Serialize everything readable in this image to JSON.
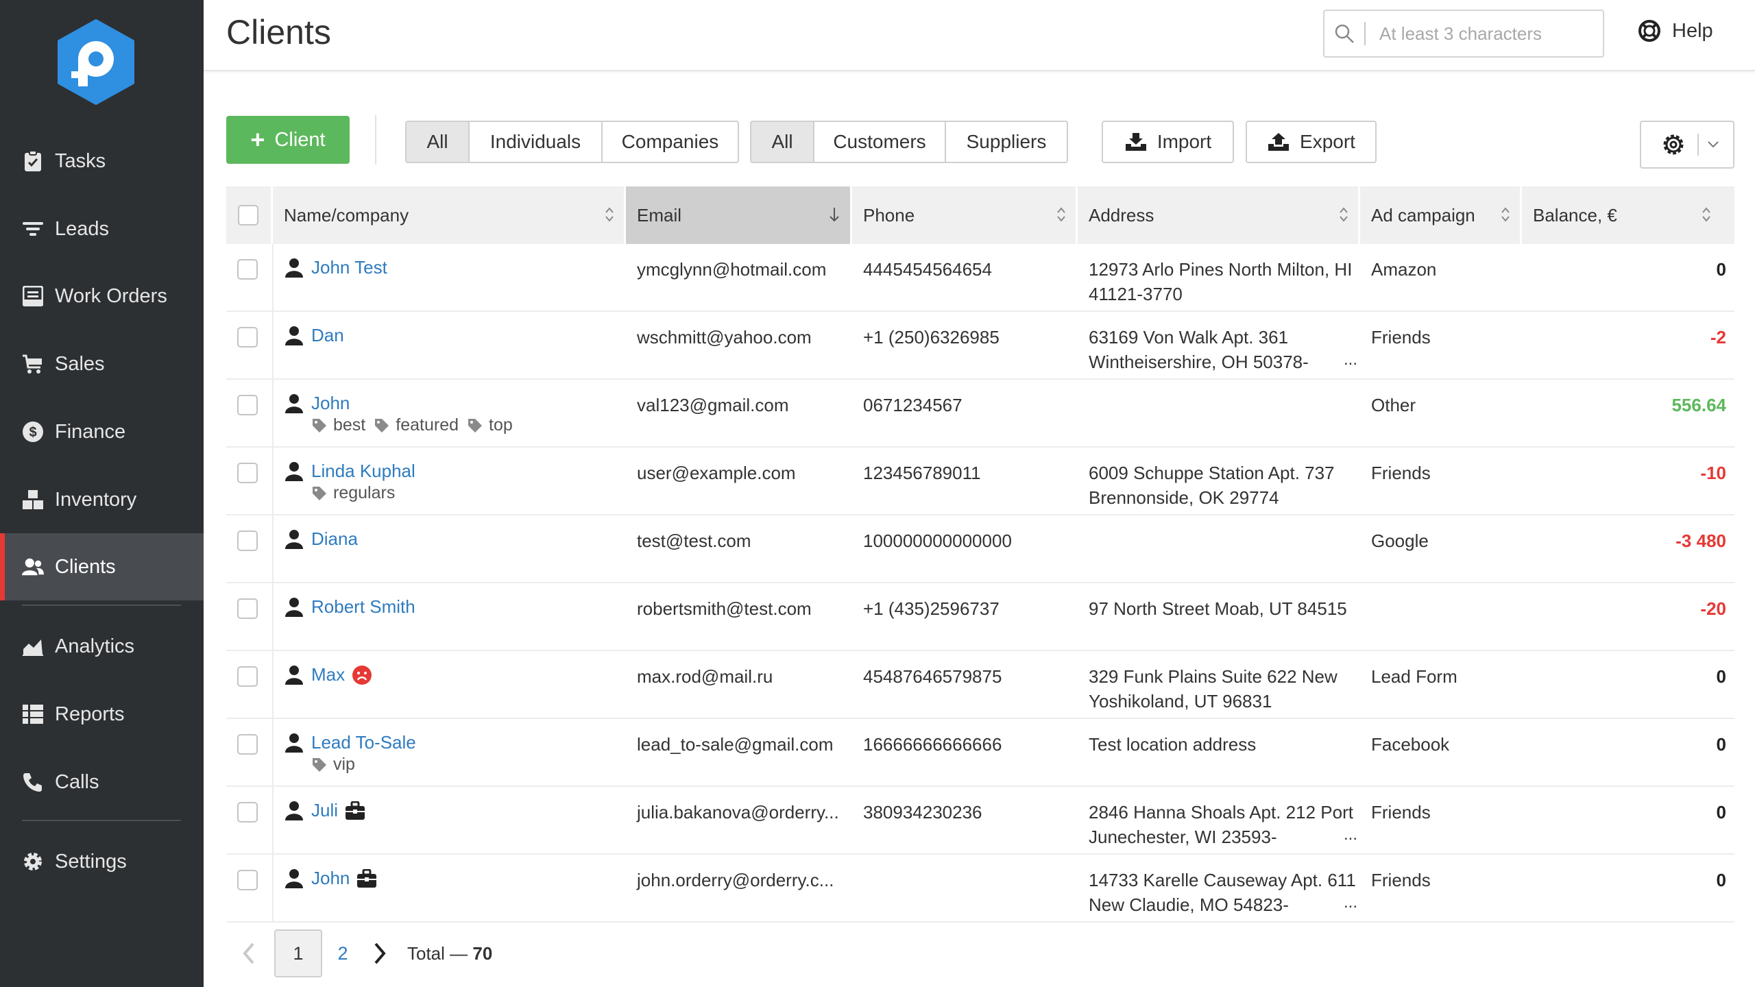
{
  "sidebar": {
    "items": [
      {
        "label": "Tasks",
        "icon": "clipboard-check-icon"
      },
      {
        "label": "Leads",
        "icon": "funnel-icon"
      },
      {
        "label": "Work Orders",
        "icon": "work-order-icon"
      },
      {
        "label": "Sales",
        "icon": "cart-icon"
      },
      {
        "label": "Finance",
        "icon": "dollar-icon"
      },
      {
        "label": "Inventory",
        "icon": "boxes-icon"
      },
      {
        "label": "Clients",
        "icon": "users-icon",
        "active": true
      },
      {
        "label": "Analytics",
        "icon": "chart-area-icon"
      },
      {
        "label": "Reports",
        "icon": "table-icon"
      },
      {
        "label": "Calls",
        "icon": "phone-icon"
      },
      {
        "label": "Settings",
        "icon": "gear-icon"
      }
    ]
  },
  "header": {
    "title": "Clients",
    "search_placeholder": "At least 3 characters",
    "help_label": "Help"
  },
  "toolbar": {
    "add_client_label": "Client",
    "type_filter": [
      "All",
      "Individuals",
      "Companies"
    ],
    "role_filter": [
      "All",
      "Customers",
      "Suppliers"
    ],
    "import_label": "Import",
    "export_label": "Export"
  },
  "table": {
    "columns": [
      "Name/company",
      "Email",
      "Phone",
      "Address",
      "Ad campaign",
      "Balance, €"
    ],
    "rows": [
      {
        "name": "John Test",
        "tags": [],
        "email": "ymcglynn@hotmail.com",
        "phone": "4445454564654",
        "address": "12973 Arlo Pines North Milton, HI 41121-3770",
        "campaign": "Amazon",
        "balance": "0",
        "balance_type": "zero"
      },
      {
        "name": "Dan",
        "tags": [],
        "email": "wschmitt@yahoo.com",
        "phone": "+1 (250)6326985",
        "address": "63169 Von Walk Apt. 361 Wintheisershire, OH 50378-",
        "address_more": "...",
        "campaign": "Friends",
        "balance": "-2",
        "balance_type": "neg"
      },
      {
        "name": "John",
        "tags": [
          "best",
          "featured",
          "top"
        ],
        "email": "val123@gmail.com",
        "phone": "0671234567",
        "address": "",
        "campaign": "Other",
        "balance": "556.64",
        "balance_type": "pos"
      },
      {
        "name": "Linda Kuphal",
        "tags": [
          "regulars"
        ],
        "email": "user@example.com",
        "phone": "123456789011",
        "address": "6009 Schuppe Station Apt. 737 Brennonside, OK 29774",
        "campaign": "Friends",
        "balance": "-10",
        "balance_type": "neg"
      },
      {
        "name": "Diana",
        "tags": [],
        "email": "test@test.com",
        "phone": "100000000000000",
        "address": "",
        "campaign": "Google",
        "balance": "-3 480",
        "balance_type": "neg"
      },
      {
        "name": "Robert Smith",
        "tags": [],
        "email": "robertsmith@test.com",
        "phone": "+1 (435)2596737",
        "address": "97 North Street Moab, UT 84515",
        "campaign": "",
        "balance": "-20",
        "balance_type": "neg"
      },
      {
        "name": "Max",
        "badge": "sad-face-icon",
        "tags": [],
        "email": "max.rod@mail.ru",
        "phone": "45487646579875",
        "address": "329 Funk Plains Suite 622 New Yoshikoland, UT 96831",
        "campaign": "Lead Form",
        "balance": "0",
        "balance_type": "zero"
      },
      {
        "name": "Lead To-Sale",
        "tags": [
          "vip"
        ],
        "email": "lead_to-sale@gmail.com",
        "phone": "16666666666666",
        "address": "Test location address",
        "campaign": "Facebook",
        "balance": "0",
        "balance_type": "zero"
      },
      {
        "name": "Juli",
        "badge": "briefcase-icon",
        "tags": [],
        "email": "julia.bakanova@orderry...",
        "phone": "380934230236",
        "address": "2846 Hanna Shoals Apt. 212 Port Junechester, WI 23593-",
        "address_more": "...",
        "campaign": "Friends",
        "balance": "0",
        "balance_type": "zero"
      },
      {
        "name": "John",
        "badge": "briefcase-icon",
        "tags": [],
        "email": "john.orderry@orderry.c...",
        "phone": "",
        "address": "14733 Karelle Causeway Apt. 611 New Claudie, MO 54823-",
        "address_more": "...",
        "campaign": "Friends",
        "balance": "0",
        "balance_type": "zero"
      }
    ]
  },
  "pagination": {
    "pages": [
      "1",
      "2"
    ],
    "current": "1",
    "total_label": "Total —",
    "total": "70"
  },
  "colors": {
    "sidebar_bg": "#2d3033",
    "active_accent": "#e53935",
    "primary_green": "#5cb85c",
    "link_blue": "#2e7bbf",
    "negative_red": "#e53935",
    "logo_blue": "#2f8fe0"
  }
}
